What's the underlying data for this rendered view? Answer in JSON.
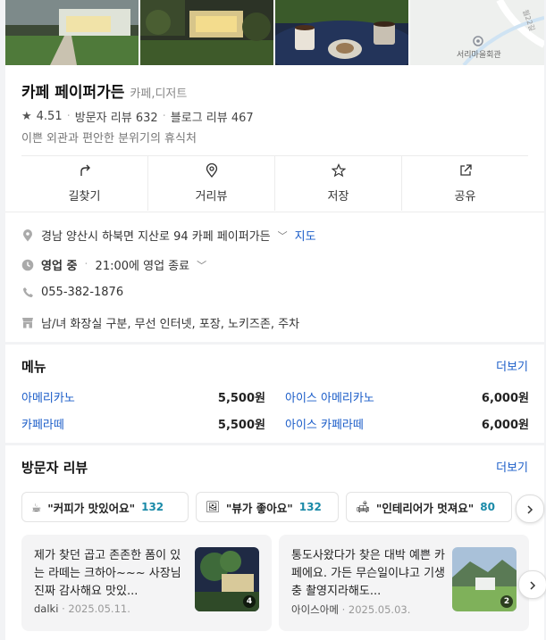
{
  "place": {
    "name": "카페 페이퍼가든",
    "category": "카페,디저트",
    "rating": "4.51",
    "visitor_reviews": "방문자 리뷰 632",
    "blog_reviews": "블로그 리뷰 467",
    "description": "이쁜 외관과 편안한 분위기의 휴식처"
  },
  "map_label": "서리마을회관",
  "map_road_label": "월22길",
  "actions": [
    {
      "label": "길찾기",
      "icon": "directions-icon"
    },
    {
      "label": "거리뷰",
      "icon": "location-pin-icon"
    },
    {
      "label": "저장",
      "icon": "star-icon"
    },
    {
      "label": "공유",
      "icon": "share-icon"
    }
  ],
  "info": {
    "address": "경남 양산시 하북면 지산로 94 카페 페이퍼가든",
    "map_link": "지도",
    "hours_status": "영업 중",
    "hours_detail": "21:00에 영업 종료",
    "phone": "055-382-1876",
    "amenities": "남/녀 화장실 구분, 무선 인터넷, 포장, 노키즈존, 주차"
  },
  "menu": {
    "title": "메뉴",
    "more": "더보기",
    "items": [
      {
        "name": "아메리카노",
        "price": "5,500원"
      },
      {
        "name": "아이스 아메리카노",
        "price": "6,000원"
      },
      {
        "name": "카페라떼",
        "price": "5,500원"
      },
      {
        "name": "아이스 카페라떼",
        "price": "6,000원"
      }
    ]
  },
  "reviews": {
    "title": "방문자 리뷰",
    "more": "더보기",
    "keywords": [
      {
        "emoji": "☕",
        "text": "\"커피가 맛있어요\"",
        "count": "132",
        "icon": "coffee-icon"
      },
      {
        "emoji": "🖼",
        "text": "\"뷰가 좋아요\"",
        "count": "132",
        "icon": "picture-icon"
      },
      {
        "emoji": "🛋",
        "text": "\"인테리어가 멋져요\"",
        "count": "80",
        "icon": "sofa-icon"
      }
    ],
    "items": [
      {
        "text": "제가 찾던 곱고 존존한 폼이 있는 라떼는 크하아~~~ 사장님 진짜 감사해요 맛있...",
        "author": "dalki",
        "date": "2025.05.11.",
        "photo_count": "4"
      },
      {
        "text": "통도사왔다가 찾은 대박 예쁜 카페에요. 가든 무슨일이냐고 기생충 촬영지라해도...",
        "author": "아이스아메",
        "date": "2025.05.03.",
        "photo_count": "2"
      }
    ]
  },
  "colors": {
    "link": "#1a5cc8",
    "keyword_count": "#1a8aa8",
    "page_bg": "#f2f3f5"
  }
}
